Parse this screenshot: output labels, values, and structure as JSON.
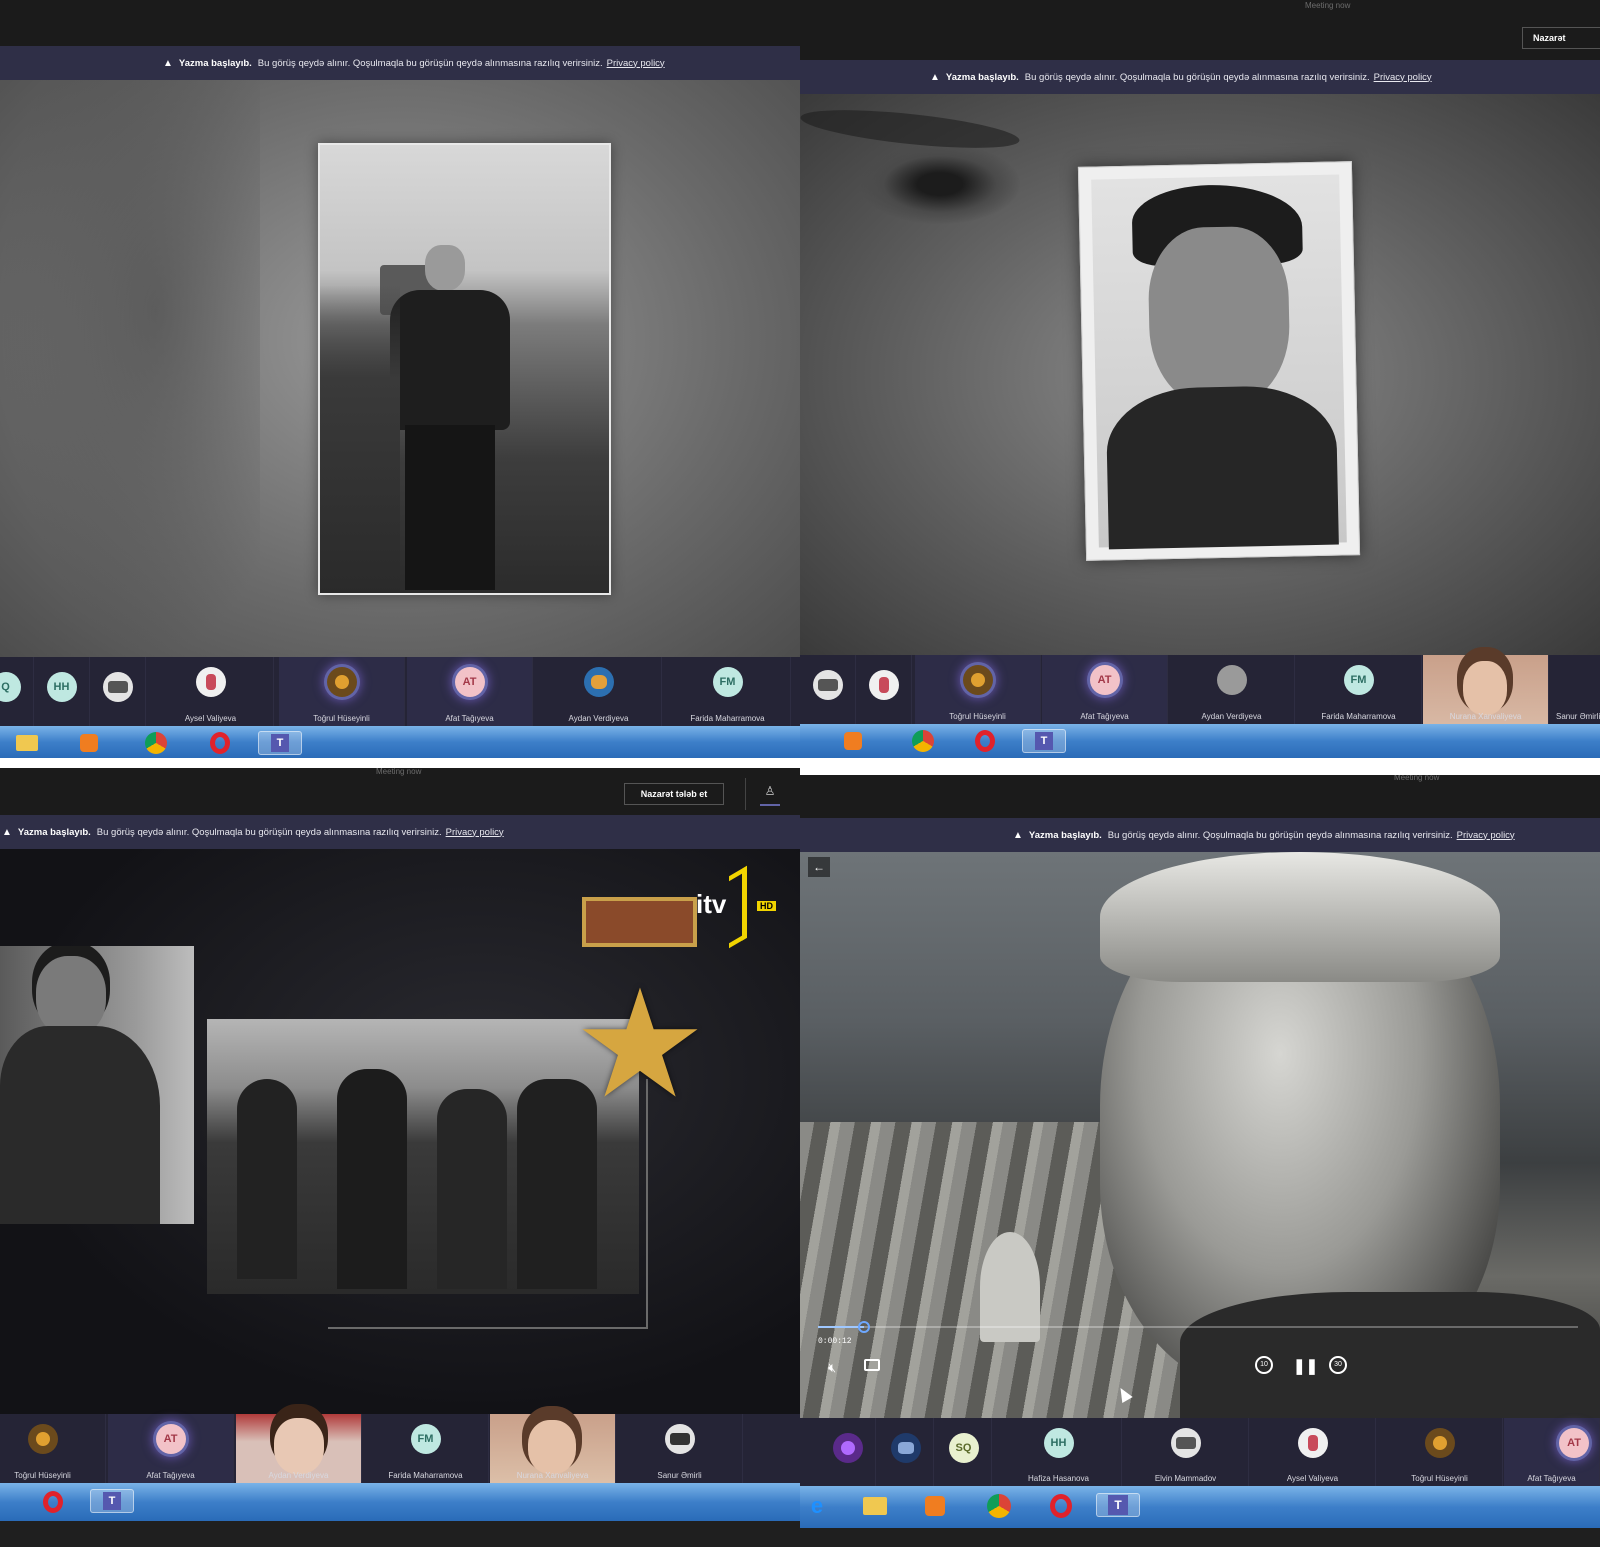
{
  "banner": {
    "bold": "Yazma başlayıb.",
    "text": "Bu görüş qeydə alınır. Qoşulmaqla bu görüşün qeydə alınmasına razılıq verirsiniz.",
    "link": "Privacy policy"
  },
  "meeting_title": "Meeting now",
  "request_control": "Nazarət tələb et",
  "request_control_cut": "Nazarət",
  "tv_logo": "itv",
  "tv_hd": "HD",
  "player": {
    "time": "0:00:12",
    "rewind": "10",
    "forward": "30",
    "progress": 0.06
  },
  "q1": {
    "participants": [
      {
        "initials": "Q",
        "name": ""
      },
      {
        "initials": "HH",
        "name": ""
      },
      {
        "initials": "",
        "name": ""
      },
      {
        "initials": "",
        "name": "Aysel Valiyeva"
      },
      {
        "initials": "",
        "name": "Toğrul Hüseyinli"
      },
      {
        "initials": "AT",
        "name": "Afat Tağıyeva"
      },
      {
        "initials": "",
        "name": "Aydan Verdiyeva"
      },
      {
        "initials": "FM",
        "name": "Farida Maharramova"
      }
    ]
  },
  "q2": {
    "participants": [
      {
        "initials": "",
        "name": ""
      },
      {
        "initials": "",
        "name": ""
      },
      {
        "initials": "",
        "name": "Toğrul Hüseyinli"
      },
      {
        "initials": "AT",
        "name": "Afat Tağıyeva"
      },
      {
        "initials": "",
        "name": "Aydan Verdiyeva"
      },
      {
        "initials": "FM",
        "name": "Farida Maharramova"
      },
      {
        "initials": "",
        "name": "Nurana Xanvaliyeva"
      },
      {
        "initials": "",
        "name": "Sanur Əmirli"
      }
    ]
  },
  "q3": {
    "participants": [
      {
        "initials": "",
        "name": "Toğrul Hüseyinli"
      },
      {
        "initials": "AT",
        "name": "Afat Tağıyeva"
      },
      {
        "initials": "",
        "name": "Aydan Verdiyeva"
      },
      {
        "initials": "FM",
        "name": "Farida Maharramova"
      },
      {
        "initials": "",
        "name": "Nurana Xanvaliyeva"
      },
      {
        "initials": "",
        "name": "Sanur Əmirli"
      }
    ]
  },
  "q4": {
    "participants": [
      {
        "initials": "",
        "name": ""
      },
      {
        "initials": "",
        "name": ""
      },
      {
        "initials": "SQ",
        "name": ""
      },
      {
        "initials": "HH",
        "name": "Hafiza Hasanova"
      },
      {
        "initials": "",
        "name": "Elvin Mammadov"
      },
      {
        "initials": "",
        "name": "Aysel Valiyeva"
      },
      {
        "initials": "",
        "name": "Toğrul Hüseyinli"
      },
      {
        "initials": "AT",
        "name": "Afat Tağıyeva"
      }
    ]
  },
  "colors": {
    "banner_bg": "#2f2f47",
    "strip_bg": "#252436",
    "teams_accent": "#6264a7",
    "avatar_at": "#f2c2c8",
    "avatar_teal": "#bfe8e1",
    "taskbar": "#3d7fc9"
  },
  "icons": [
    "warning-icon",
    "folder-icon",
    "media-player-icon",
    "chrome-icon",
    "opera-icon",
    "teams-icon",
    "ie-icon",
    "back-arrow-icon",
    "mute-icon",
    "captions-icon",
    "rewind-icon",
    "pause-icon",
    "forward-icon",
    "people-icon",
    "cursor-icon",
    "medal-star-icon"
  ]
}
